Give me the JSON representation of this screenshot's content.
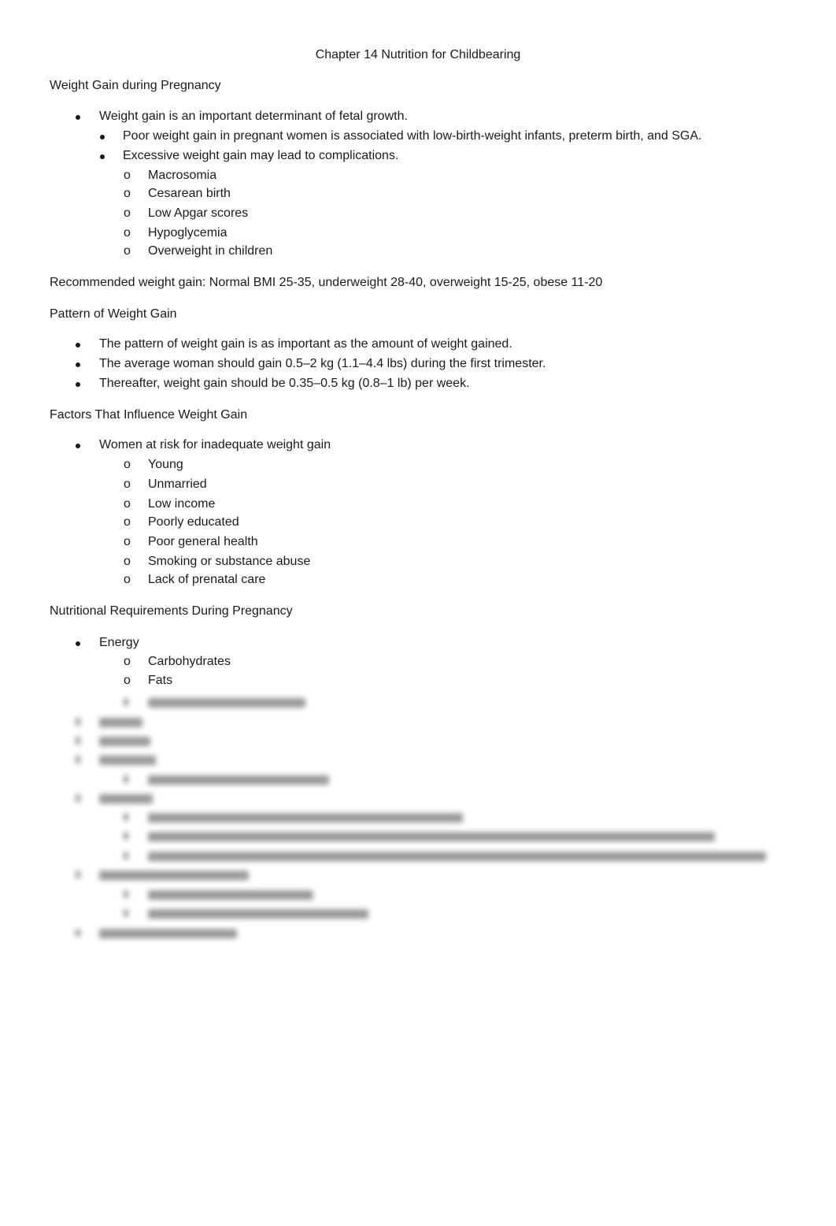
{
  "document": {
    "title": "Chapter 14 Nutrition for Childbearing",
    "sections": [
      {
        "heading": "Weight Gain during Pregnancy",
        "items": [
          {
            "level": 1,
            "marker": "disc",
            "text": "Weight gain is an important determinant of fetal growth."
          },
          {
            "level": 2,
            "marker": "disc",
            "text": "Poor weight gain in pregnant women is associated with low-birth-weight infants, preterm birth, and SGA."
          },
          {
            "level": 2,
            "marker": "disc",
            "text": "Excessive weight gain may lead to complications."
          },
          {
            "level": 3,
            "marker": "o",
            "text": "Macrosomia"
          },
          {
            "level": 3,
            "marker": "o",
            "text": "Cesarean birth"
          },
          {
            "level": 3,
            "marker": "o",
            "text": "Low Apgar scores"
          },
          {
            "level": 3,
            "marker": "o",
            "text": "Hypoglycemia"
          },
          {
            "level": 3,
            "marker": "o",
            "text": "Overweight in children"
          }
        ]
      },
      {
        "paragraph": "Recommended weight gain:  Normal BMI 25-35, underweight 28-40, overweight 15-25, obese 11-20"
      },
      {
        "heading": "Pattern of Weight Gain",
        "items": [
          {
            "level": 1,
            "marker": "disc",
            "text": "The pattern of weight gain is as important as the amount of weight gained."
          },
          {
            "level": 1,
            "marker": "disc",
            "text": "The average woman should gain 0.5–2 kg (1.1–4.4 lbs) during the first trimester."
          },
          {
            "level": 1,
            "marker": "disc",
            "text": "Thereafter, weight gain should be 0.35–0.5 kg (0.8–1 lb) per week."
          }
        ]
      },
      {
        "heading": "Factors That Influence Weight Gain",
        "items": [
          {
            "level": 1,
            "marker": "disc",
            "text": "Women at risk for inadequate weight gain"
          },
          {
            "level": 3,
            "marker": "o",
            "text": "Young"
          },
          {
            "level": 3,
            "marker": "o",
            "text": "Unmarried"
          },
          {
            "level": 3,
            "marker": "o",
            "text": "Low income"
          },
          {
            "level": 3,
            "marker": "o",
            "text": "Poorly educated"
          },
          {
            "level": 3,
            "marker": "o",
            "text": "Poor general health"
          },
          {
            "level": 3,
            "marker": "o",
            "text": "Smoking or substance abuse"
          },
          {
            "level": 3,
            "marker": "o",
            "text": "Lack of prenatal care"
          }
        ]
      },
      {
        "heading": "Nutritional Requirements During Pregnancy",
        "items": [
          {
            "level": 1,
            "marker": "disc",
            "text": "Energy"
          },
          {
            "level": 3,
            "marker": "o",
            "text": "Carbohydrates"
          },
          {
            "level": 3,
            "marker": "o",
            "text": "Fats"
          }
        ]
      }
    ],
    "blurred_notice": "Remaining content is blurred (preview)"
  }
}
